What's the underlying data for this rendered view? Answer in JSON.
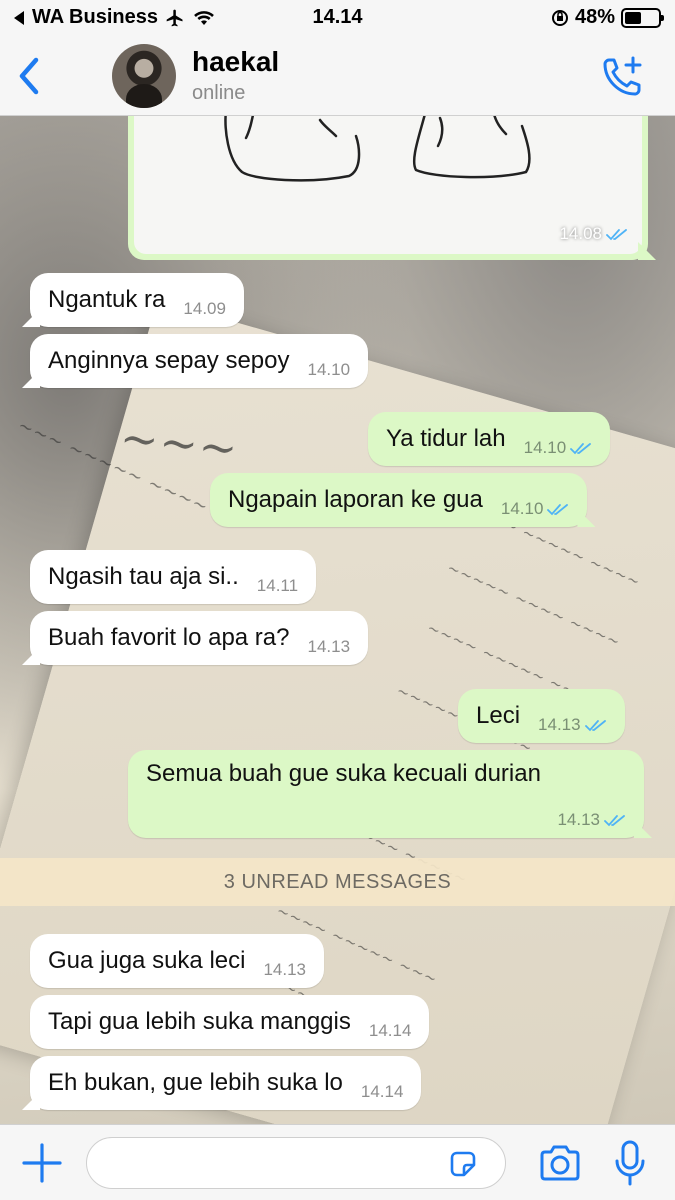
{
  "status_bar": {
    "carrier": "WA Business",
    "time": "14.14",
    "battery": "48%"
  },
  "header": {
    "contact_name": "haekal",
    "contact_status": "online"
  },
  "image_message": {
    "time": "14.08"
  },
  "messages": [
    {
      "direction": "in",
      "text": "Ngantuk ra",
      "time": "14.09"
    },
    {
      "direction": "in",
      "text": "Anginnya sepay sepoy",
      "time": "14.10"
    },
    {
      "direction": "out",
      "text": "Ya tidur lah",
      "time": "14.10"
    },
    {
      "direction": "out",
      "text": "Ngapain laporan ke gua",
      "time": "14.10"
    },
    {
      "direction": "in",
      "text": "Ngasih tau aja si..",
      "time": "14.11"
    },
    {
      "direction": "in",
      "text": "Buah favorit lo apa ra?",
      "time": "14.13"
    },
    {
      "direction": "out",
      "text": "Leci",
      "time": "14.13"
    },
    {
      "direction": "out",
      "text": "Semua buah gue suka kecuali durian",
      "time": "14.13"
    },
    {
      "direction": "in",
      "text": "Gua juga suka leci",
      "time": "14.13"
    },
    {
      "direction": "in",
      "text": "Tapi gua lebih suka manggis",
      "time": "14.14"
    },
    {
      "direction": "in",
      "text": "Eh bukan, gue lebih suka lo",
      "time": "14.14"
    }
  ],
  "unread_banner": "3 UNREAD MESSAGES",
  "input": {
    "value": "",
    "placeholder": ""
  },
  "colors": {
    "accent": "#1e7bf0",
    "outgoing_bubble": "#dcf8c6",
    "incoming_bubble": "#ffffff",
    "read_ticks": "#4fb3f6"
  },
  "icons": [
    "back-chevron-icon",
    "add-call-icon",
    "airplane-icon",
    "wifi-icon",
    "orientation-lock-icon",
    "battery-icon",
    "plus-icon",
    "sticker-icon",
    "camera-icon",
    "microphone-icon",
    "double-check-icon"
  ]
}
